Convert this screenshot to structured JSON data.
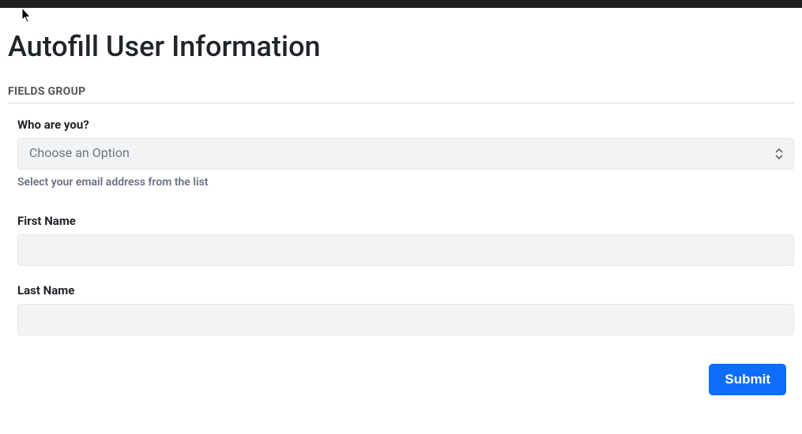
{
  "page": {
    "title": "Autofill User Information"
  },
  "section": {
    "header": "FIELDS GROUP"
  },
  "who": {
    "label": "Who are you?",
    "placeholder": "Choose an Option",
    "help": "Select your email address from the list"
  },
  "firstName": {
    "label": "First Name",
    "value": ""
  },
  "lastName": {
    "label": "Last Name",
    "value": ""
  },
  "actions": {
    "submit": "Submit"
  }
}
